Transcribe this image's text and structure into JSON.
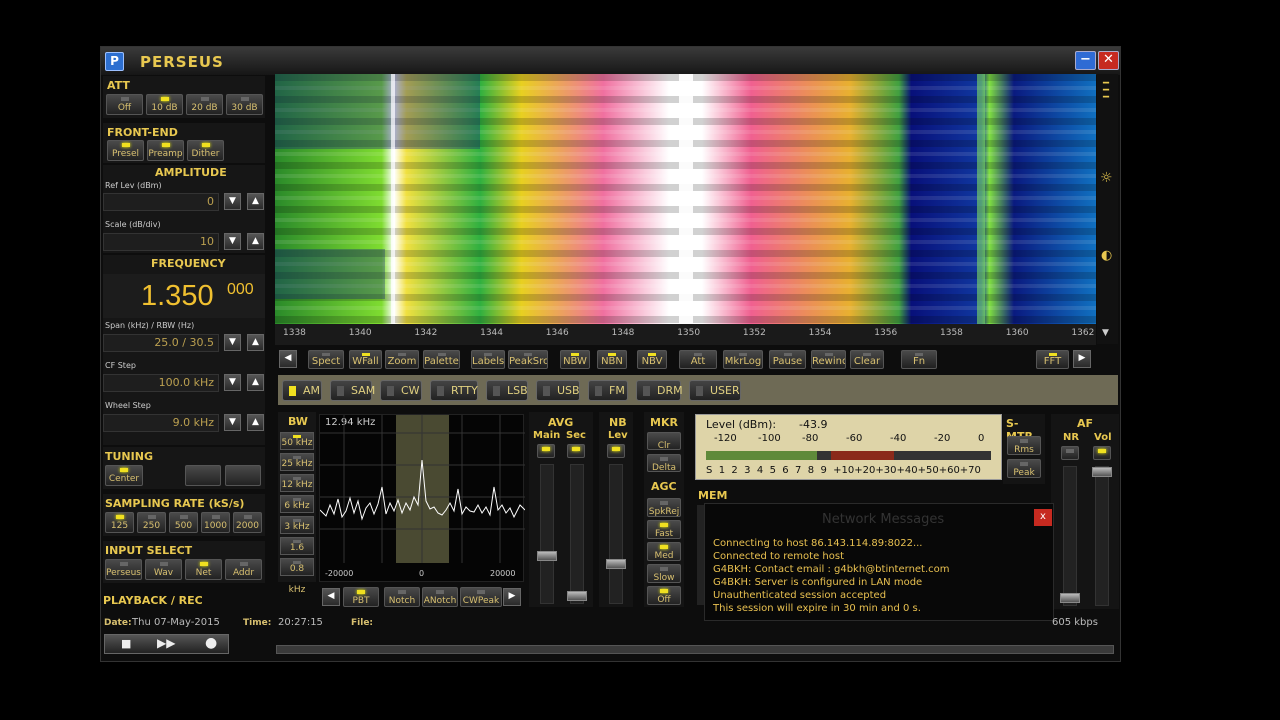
{
  "app": {
    "title": "PERSEUS",
    "logo": "P"
  },
  "window": {
    "min": "−",
    "close": "✕"
  },
  "att": {
    "title": "ATT",
    "buttons": [
      {
        "label": "Off",
        "on": false
      },
      {
        "label": "10 dB",
        "on": true
      },
      {
        "label": "20 dB",
        "on": false
      },
      {
        "label": "30 dB",
        "on": false
      }
    ]
  },
  "frontend": {
    "title": "FRONT-END",
    "buttons": [
      {
        "label": "Presel",
        "on": true
      },
      {
        "label": "Preamp",
        "on": true
      },
      {
        "label": "Dither",
        "on": true
      }
    ]
  },
  "amplitude": {
    "title": "AMPLITUDE",
    "ref_label": "Ref Lev (dBm)",
    "ref_value": "0",
    "scale_label": "Scale (dB/div)",
    "scale_value": "10"
  },
  "frequency": {
    "title": "FREQUENCY",
    "main": "1.350",
    "sub": "000",
    "span_label": "Span (kHz) / RBW (Hz)",
    "span_value": "25.0 / 30.5",
    "cf_label": "CF Step",
    "cf_value": "100.0 kHz",
    "wheel_label": "Wheel Step",
    "wheel_value": "9.0 kHz"
  },
  "tuning": {
    "title": "TUNING",
    "center": "Center"
  },
  "sampling": {
    "title": "SAMPLING RATE (kS/s)",
    "buttons": [
      {
        "label": "125",
        "on": true
      },
      {
        "label": "250",
        "on": false
      },
      {
        "label": "500",
        "on": false
      },
      {
        "label": "1000",
        "on": false
      },
      {
        "label": "2000",
        "on": false
      }
    ]
  },
  "input": {
    "title": "INPUT SELECT",
    "buttons": [
      {
        "label": "Perseus",
        "on": false
      },
      {
        "label": "Wav",
        "on": false
      },
      {
        "label": "Net",
        "on": true
      },
      {
        "label": "Addr",
        "on": false
      }
    ]
  },
  "playback": {
    "title": "PLAYBACK / REC"
  },
  "status": {
    "date_label": "Date:",
    "date": "Thu 07-May-2015",
    "time_label": "Time:",
    "time": "20:27:15",
    "file_label": "File:",
    "rate": "605 kbps"
  },
  "axis": {
    "ticks": [
      "1338",
      "1340",
      "1342",
      "1344",
      "1346",
      "1348",
      "1350",
      "1352",
      "1354",
      "1356",
      "1358",
      "1360",
      "1362"
    ]
  },
  "toolbar": [
    {
      "label": "Spect",
      "on": false
    },
    {
      "label": "WFall",
      "on": true
    },
    {
      "label": "Zoom",
      "on": false
    },
    {
      "label": "Palette",
      "on": false
    },
    {
      "label": "Labels",
      "on": false
    },
    {
      "label": "PeakSrc",
      "on": false
    },
    {
      "label": "NBW",
      "on": true
    },
    {
      "label": "NBN",
      "on": true
    },
    {
      "label": "NBV",
      "on": true
    },
    {
      "label": "Att",
      "on": false
    },
    {
      "label": "MkrLog",
      "on": false
    },
    {
      "label": "Pause",
      "on": false
    },
    {
      "label": "Rewind",
      "on": false
    },
    {
      "label": "Clear",
      "on": false
    },
    {
      "label": "Fn",
      "on": false
    },
    {
      "label": "FFT",
      "on": true
    }
  ],
  "modes": [
    {
      "label": "AM",
      "on": true
    },
    {
      "label": "SAM",
      "on": false
    },
    {
      "label": "CW",
      "on": false
    },
    {
      "label": "RTTY",
      "on": false
    },
    {
      "label": "LSB",
      "on": false
    },
    {
      "label": "USB",
      "on": false
    },
    {
      "label": "FM",
      "on": false
    },
    {
      "label": "DRM",
      "on": false
    },
    {
      "label": "USER",
      "on": false
    }
  ],
  "bw": {
    "title": "BW",
    "value": "12.94 kHz",
    "buttons": [
      {
        "label": "50 kHz",
        "on": true
      },
      {
        "label": "25 kHz",
        "on": false
      },
      {
        "label": "12 kHz",
        "on": false
      },
      {
        "label": "6 kHz",
        "on": false
      },
      {
        "label": "3 kHz",
        "on": false
      },
      {
        "label": "1.6 kHz",
        "on": false
      },
      {
        "label": "0.8 kHz",
        "on": false
      }
    ],
    "xticks": [
      "-20000",
      "0",
      "20000"
    ]
  },
  "filter_buttons": [
    {
      "label": "PBT",
      "on": true
    },
    {
      "label": "Notch",
      "on": false
    },
    {
      "label": "ANotch",
      "on": false
    },
    {
      "label": "CWPeak",
      "on": false
    }
  ],
  "avg": {
    "title": "AVG",
    "main": "Main",
    "sec": "Sec"
  },
  "nb": {
    "title": "NB",
    "lev": "Lev"
  },
  "mkr": {
    "title": "MKR",
    "clr": "Clr",
    "delta": "Delta"
  },
  "agc": {
    "title": "AGC",
    "buttons": [
      {
        "label": "SpkRej",
        "on": false
      },
      {
        "label": "Fast",
        "on": true
      },
      {
        "label": "Med",
        "on": true
      },
      {
        "label": "Slow",
        "on": false
      },
      {
        "label": "Off",
        "on": true
      }
    ]
  },
  "meter": {
    "label": "Level (dBm):",
    "value": "-43.9",
    "dbm_scale": [
      "-120",
      "-100",
      "-80",
      "-60",
      "-40",
      "-20",
      "0"
    ],
    "s_scale": "S  1  2  3  4  5  6  7  8  9  +10+20+30+40+50+60+70",
    "level_fraction": 0.39
  },
  "smtr": {
    "title": "S-MTR",
    "rms": "Rms",
    "peak": "Peak"
  },
  "af": {
    "title": "AF",
    "nr": "NR",
    "vol": "Vol"
  },
  "mem": {
    "title": "MEM"
  },
  "network": {
    "title": "Network Messages",
    "close": "x",
    "lines": [
      "Connecting to host 86.143.114.89:8022...",
      "Connected to remote host",
      "G4BKH: Contact email : g4bkh@btinternet.com",
      "G4BKH: Server is configured in LAN mode",
      "Unauthenticated session accepted",
      "This session will expire in 30 min and 0 s."
    ]
  },
  "colors": {
    "accent": "#e8c850",
    "led": "#f0e020"
  }
}
